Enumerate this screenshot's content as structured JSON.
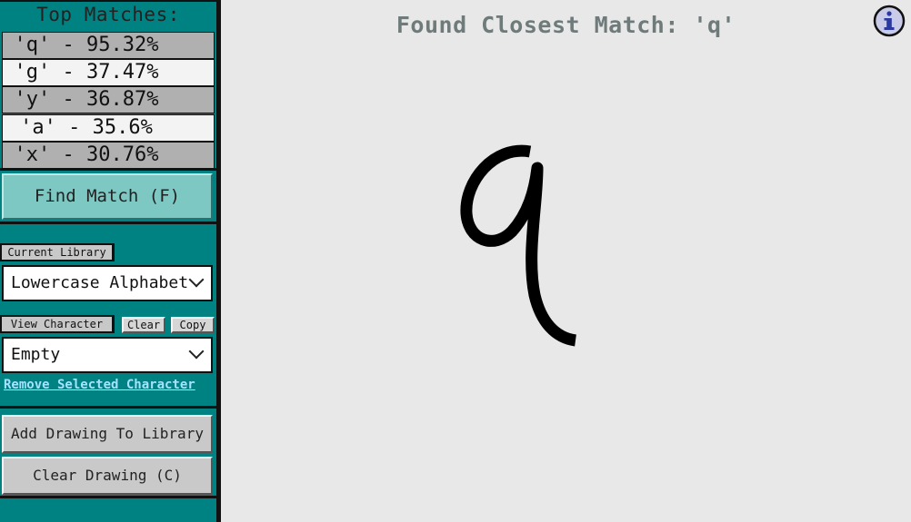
{
  "sidebar": {
    "title": "Top Matches:",
    "matches": [
      {
        "label": "'q' - 95.32%"
      },
      {
        "label": "'g' - 37.47%"
      },
      {
        "label": "'y' - 36.87%"
      },
      {
        "label": "'a' - 35.6%"
      },
      {
        "label": "'x' - 30.76%"
      }
    ],
    "find_button": "Find Match (F)",
    "current_library_label": "Current Library",
    "library_value": "Lowercase Alphabet",
    "view_character_label": "View Character",
    "clear_button": "Clear",
    "copy_button": "Copy",
    "character_value": "Empty",
    "remove_link": "Remove Selected Character",
    "add_button": "Add Drawing To Library (S)",
    "clear_drawing_button": "Clear Drawing (C)"
  },
  "canvas": {
    "result_text": "Found Closest Match: 'q'",
    "drawn_character": "q",
    "info_icon": "info-icon"
  },
  "colors": {
    "sidebar_bg": "#018282",
    "find_button_bg": "#7ec8c4",
    "canvas_bg": "#e8e8e8",
    "link": "#a6e2ff",
    "result_text": "#6e7b7a"
  }
}
